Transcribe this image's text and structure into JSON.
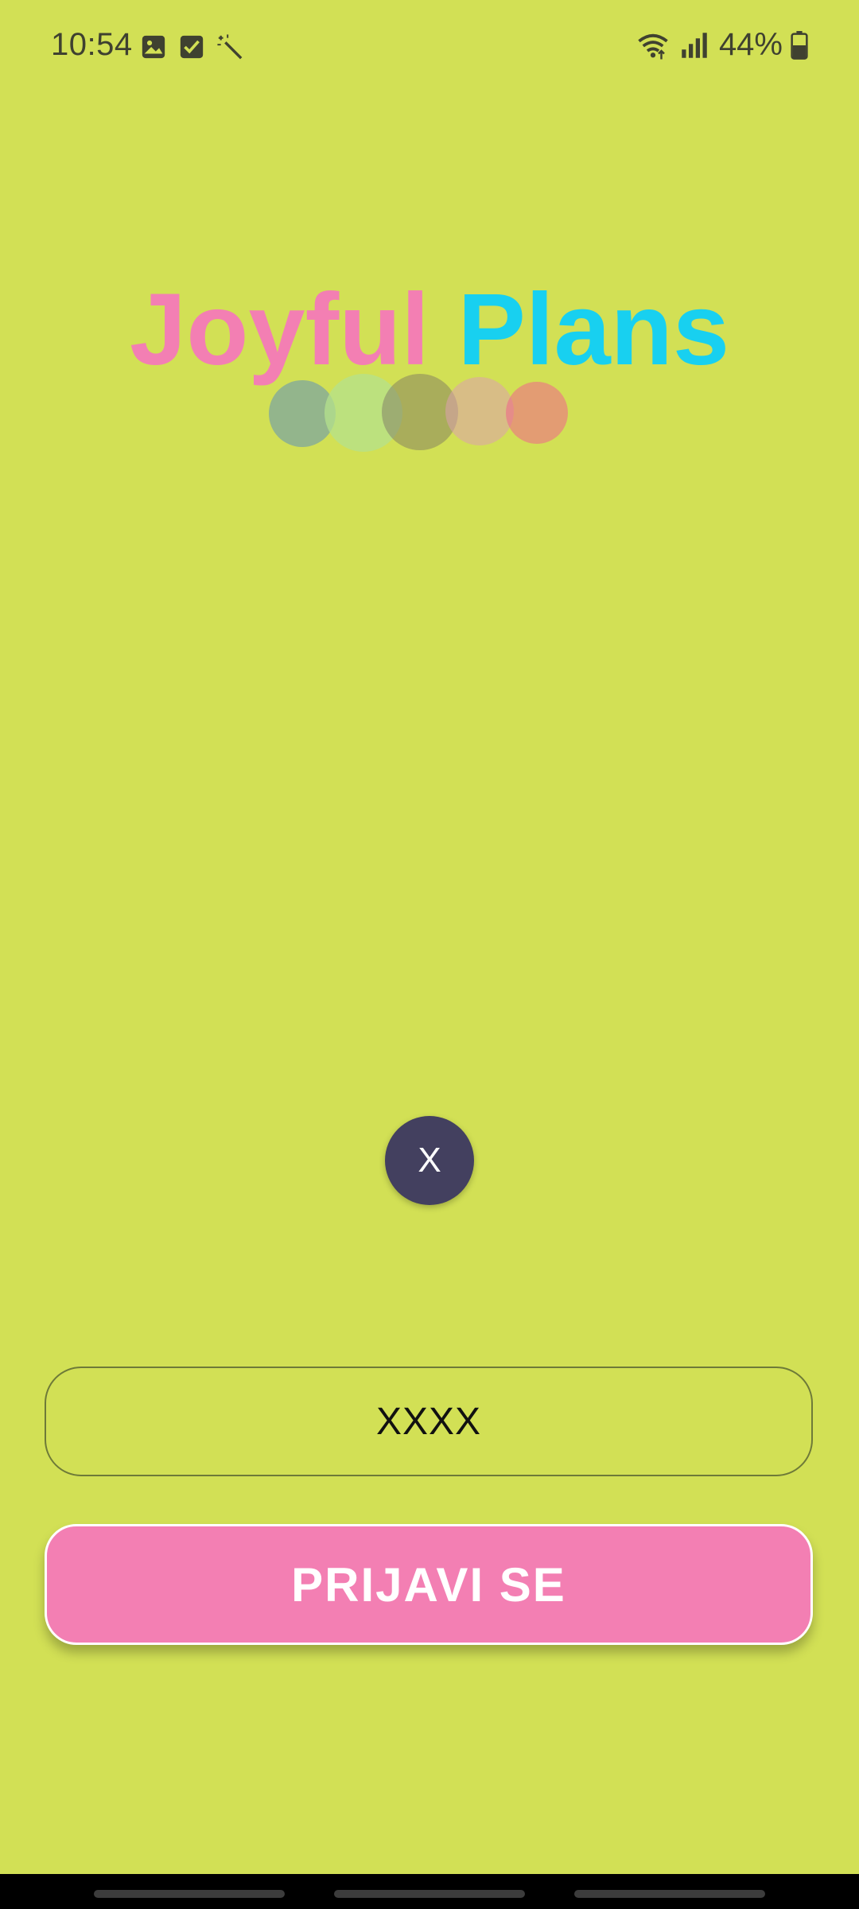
{
  "status_bar": {
    "time": "10:54",
    "left_icons": [
      "image-icon",
      "checkbox-icon",
      "magic-wand-icon"
    ],
    "right_icons": [
      "wifi-icon",
      "signal-icon"
    ],
    "battery_percent": "44%"
  },
  "title": {
    "word1": "Joyful",
    "word2": "Plans",
    "colors": {
      "word1": "#f37fb3",
      "word2": "#18d0f0"
    }
  },
  "close_button": {
    "label": "X"
  },
  "code_field": {
    "value": "XXXX"
  },
  "login_button": {
    "label": "PRIJAVI SE"
  },
  "colors": {
    "background": "#d2e055",
    "accent_pink": "#f37fb3",
    "accent_cyan": "#18d0f0",
    "dark_button": "#43405f"
  }
}
